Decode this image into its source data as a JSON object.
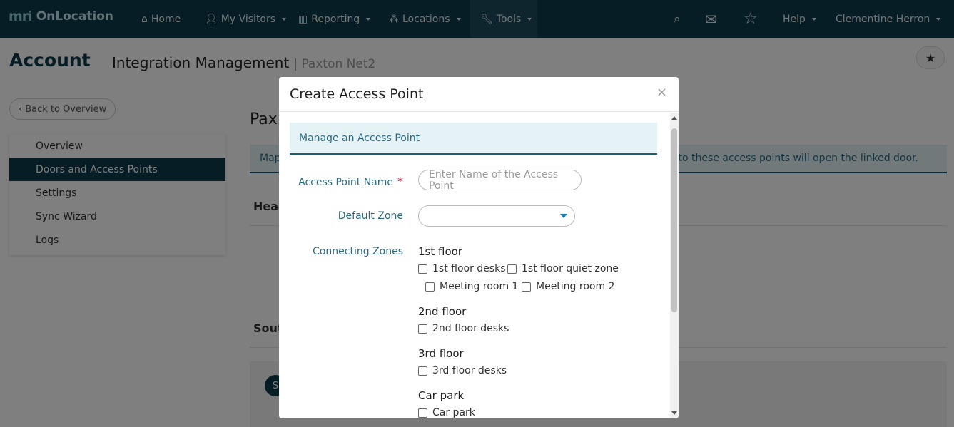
{
  "nav": {
    "brand_logo": "mri",
    "brand_name": "OnLocation",
    "items": [
      {
        "label": "Home",
        "icon": "home-icon"
      },
      {
        "label": "My Visitors",
        "icon": "user-icon"
      },
      {
        "label": "Reporting",
        "icon": "bar-chart-icon"
      },
      {
        "label": "Locations",
        "icon": "sitemap-icon"
      },
      {
        "label": "Tools",
        "icon": "wrench-icon"
      }
    ],
    "help": "Help",
    "user": "Clementine Herron"
  },
  "page": {
    "title": "Account",
    "subtitle": "Integration Management",
    "subtitle_context": "| Paxton Net2",
    "back_label": "Back to Overview",
    "heading_partial": "Pax",
    "info_partial_left": "Map",
    "info_partial_right": "ted to these access points will open the linked door.",
    "section1_partial": "Head",
    "section2_partial": "Sout",
    "pill_partial": "S"
  },
  "sidebar": {
    "items": [
      {
        "label": "Overview"
      },
      {
        "label": "Doors and Access Points",
        "active": true
      },
      {
        "label": "Settings"
      },
      {
        "label": "Sync Wizard"
      },
      {
        "label": "Logs"
      }
    ]
  },
  "modal": {
    "title": "Create Access Point",
    "close": "×",
    "panel_heading": "Manage an Access Point",
    "access_point_name_label": "Access Point Name",
    "required_mark": "*",
    "access_point_name_placeholder": "Enter Name of the Access Point",
    "default_zone_label": "Default Zone",
    "default_zone_value": "",
    "connecting_zones_label": "Connecting Zones",
    "zones": [
      {
        "floor": "1st floor",
        "options": [
          "1st floor desks",
          "1st floor quiet zone",
          "Meeting room 1",
          "Meeting room 2"
        ]
      },
      {
        "floor": "2nd floor",
        "options": [
          "2nd floor desks"
        ]
      },
      {
        "floor": "3rd floor",
        "options": [
          "3rd floor desks"
        ]
      },
      {
        "floor": "Car park",
        "options": [
          "Car park"
        ]
      }
    ]
  },
  "colors": {
    "navbar": "#0d3a4c",
    "accent": "#2c6a80",
    "required": "#c9264f",
    "dropdown_arrow": "#1a7ab5"
  }
}
